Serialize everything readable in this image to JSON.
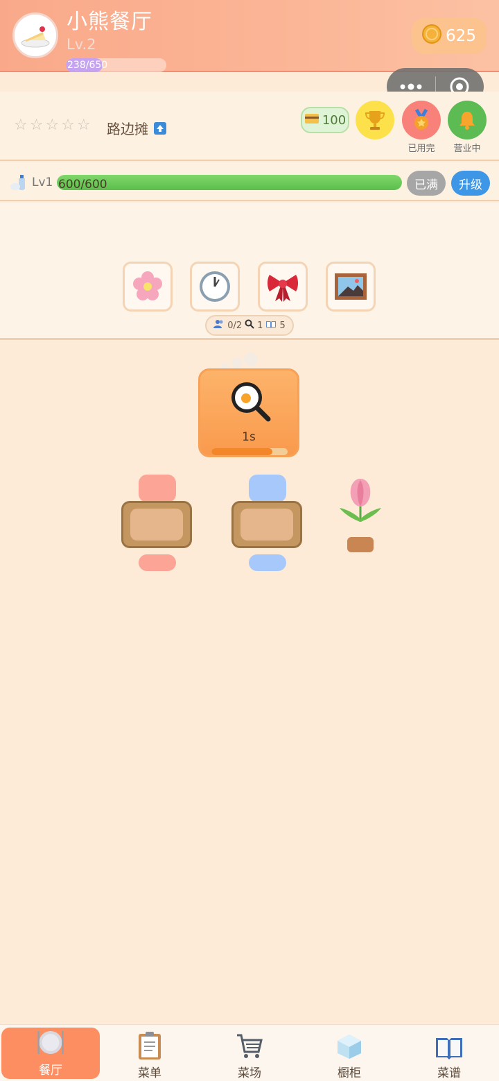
{
  "header": {
    "shop_name": "小熊餐厅",
    "level": "Lv.2",
    "xp": "238/650",
    "xp_progress": 0.366,
    "coins": "625"
  },
  "shop_info": {
    "stars": "☆☆☆☆☆",
    "stall_name": "路边摊",
    "ticket_count": "100",
    "medal_label": "已用完",
    "bell_label": "营业中"
  },
  "energy": {
    "level": "Lv1",
    "value": "600/600",
    "progress": 1.0,
    "full_label": "已满",
    "upgrade_label": "升级"
  },
  "decor": {
    "items": [
      "cherry-blossom-icon",
      "clock-icon",
      "ribbon-icon",
      "framed-picture-icon"
    ],
    "stats": {
      "customers": "0/2",
      "search": "1",
      "recipes": "5"
    }
  },
  "kitchen": {
    "stove_time": "1s",
    "stove_progress": 0.8
  },
  "colors": {
    "accent": "#fd8e62",
    "energy_green": "#5cbe4c",
    "upgrade_blue": "#3d96e6"
  },
  "nav": {
    "items": [
      {
        "label": "餐厅",
        "icon": "plate-icon"
      },
      {
        "label": "菜单",
        "icon": "clipboard-icon"
      },
      {
        "label": "菜场",
        "icon": "cart-icon"
      },
      {
        "label": "橱柜",
        "icon": "ice-cube-icon"
      },
      {
        "label": "菜谱",
        "icon": "book-icon"
      }
    ]
  }
}
